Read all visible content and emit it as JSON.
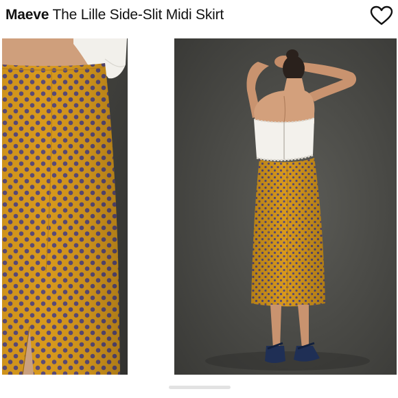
{
  "product": {
    "brand": "Maeve",
    "name": " The Lille Side-Slit Midi Skirt"
  },
  "icons": {
    "favorite": "heart-outline-icon"
  },
  "gallery": {
    "images": [
      {
        "subject": "skirt-closeup-photo"
      },
      {
        "subject": "model-back-view-photo"
      }
    ]
  },
  "colors": {
    "skirt": "#d99a1d",
    "dots": "#5b4b78",
    "background_right": "#4f4f4b",
    "background_left": "#3f3f3b"
  }
}
